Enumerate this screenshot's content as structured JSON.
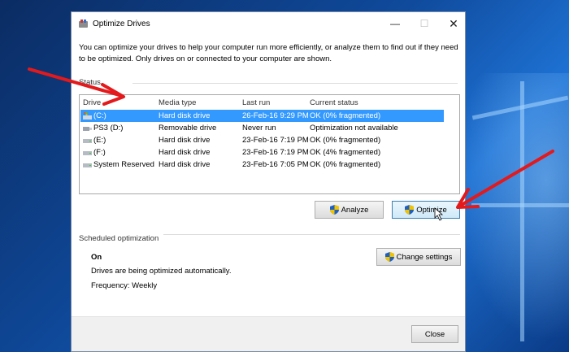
{
  "window": {
    "title": "Optimize Drives",
    "description": "You can optimize your drives to help your computer run more efficiently, or analyze them to find out if they need to be optimized. Only drives on or connected to your computer are shown."
  },
  "status": {
    "label": "Status",
    "columns": [
      "Drive",
      "Media type",
      "Last run",
      "Current status"
    ],
    "rows": [
      {
        "drive": "(C:)",
        "media": "Hard disk drive",
        "last_run": "26-Feb-16 9:29 PM",
        "status": "OK (0% fragmented)",
        "selected": true,
        "icon": "windows-drive-icon"
      },
      {
        "drive": "PS3 (D:)",
        "media": "Removable drive",
        "last_run": "Never run",
        "status": "Optimization not available",
        "selected": false,
        "icon": "usb-drive-icon"
      },
      {
        "drive": "(E:)",
        "media": "Hard disk drive",
        "last_run": "23-Feb-16 7:19 PM",
        "status": "OK (0% fragmented)",
        "selected": false,
        "icon": "hard-drive-icon"
      },
      {
        "drive": "(F:)",
        "media": "Hard disk drive",
        "last_run": "23-Feb-16 7:19 PM",
        "status": "OK (4% fragmented)",
        "selected": false,
        "icon": "hard-drive-icon"
      },
      {
        "drive": "System Reserved",
        "media": "Hard disk drive",
        "last_run": "23-Feb-16 7:05 PM",
        "status": "OK (0% fragmented)",
        "selected": false,
        "icon": "hard-drive-icon"
      }
    ]
  },
  "actions": {
    "analyze_label": "Analyze",
    "optimize_label": "Optimize"
  },
  "scheduled": {
    "label": "Scheduled optimization",
    "state": "On",
    "message": "Drives are being optimized automatically.",
    "frequency": "Frequency: Weekly",
    "change_settings_label": "Change settings"
  },
  "footer": {
    "close_label": "Close"
  },
  "colors": {
    "selection": "#3399ff",
    "annotation_arrow": "#e3191c",
    "desktop_blue": "#0f4a9c"
  }
}
